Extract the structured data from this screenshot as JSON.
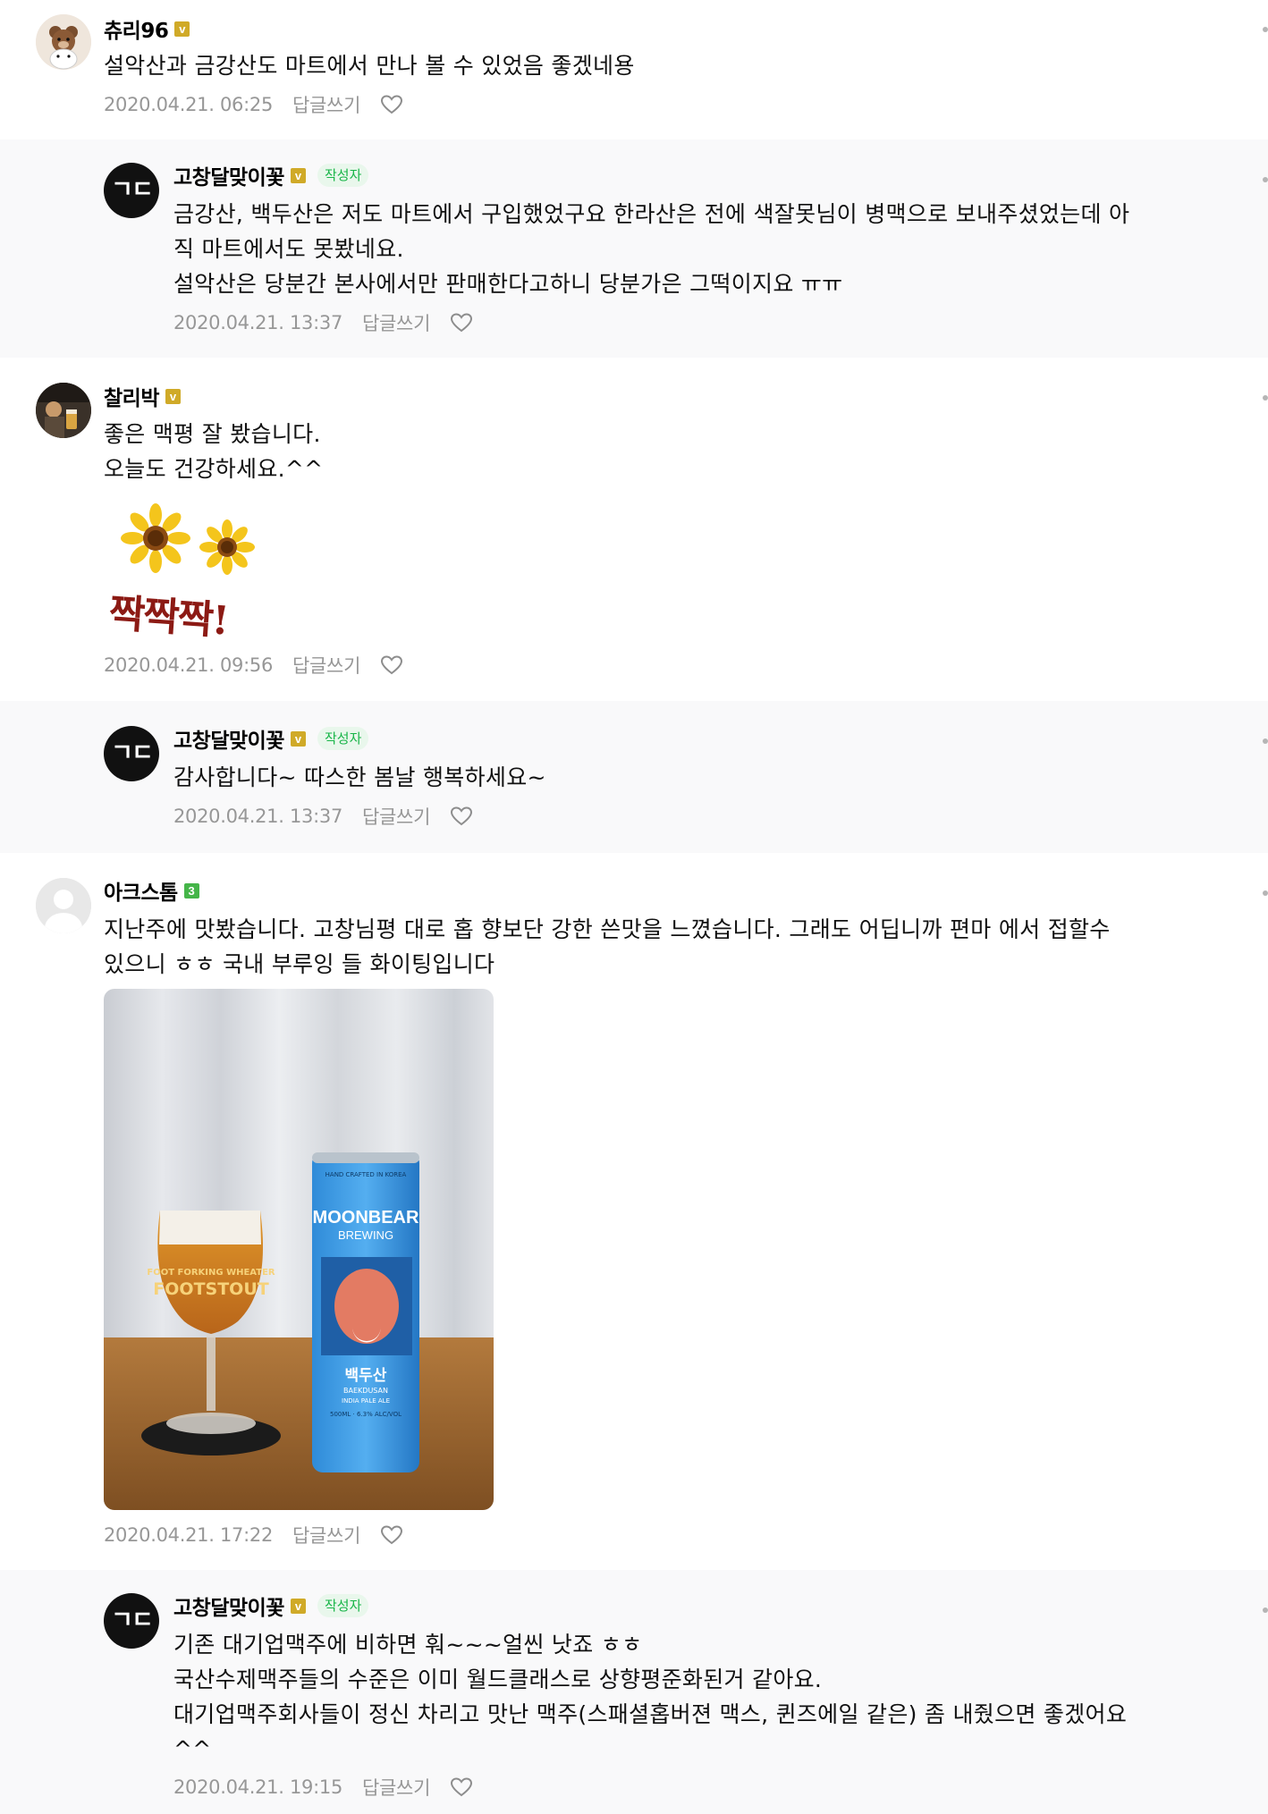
{
  "comments": [
    {
      "nickname": "츄리96",
      "badge": "v",
      "text": "설악산과 금강산도 마트에서 만나 볼 수 있었음 좋겠네용",
      "date": "2020.04.21. 06:25",
      "reply_label": "답글쓰기"
    },
    {
      "nickname": "고창달맞이꽃",
      "badge": "v",
      "author_tag": "작성자",
      "avatar_text": "ㄱㄷ",
      "text": "금강산, 백두산은 저도 마트에서 구입했었구요 한라산은 전에 색잘못님이 병맥으로 보내주셨었는데 아\n직 마트에서도 못봤네요.\n설악산은 당분간 본사에서만 판매한다고하니 당분가은 그떡이지요 ㅠㅠ",
      "date": "2020.04.21. 13:37",
      "reply_label": "답글쓰기"
    },
    {
      "nickname": "찰리박",
      "badge": "v",
      "text": "좋은 맥평 잘 봤습니다.\n오늘도 건강하세요.^^",
      "sticker_text": "짝짝짝!",
      "date": "2020.04.21. 09:56",
      "reply_label": "답글쓰기"
    },
    {
      "nickname": "고창달맞이꽃",
      "badge": "v",
      "author_tag": "작성자",
      "avatar_text": "ㄱㄷ",
      "text": "감사합니다~ 따스한 봄날 행복하세요~",
      "date": "2020.04.21. 13:37",
      "reply_label": "답글쓰기"
    },
    {
      "nickname": "아크스톰",
      "badge": "3",
      "text": "지난주에 맛봤습니다. 고창님평 대로 홉 향보단 강한 쓴맛을 느꼈습니다. 그래도 어딥니까 편마 에서 접할수\n있으니 ㅎㅎ 국내 부루잉 들 화이팅입니다",
      "photo": {
        "can_brand": "MOONBEAR",
        "can_sub": "BREWING",
        "can_top": "HAND CRAFTED IN KOREA",
        "can_name": "백두산",
        "can_name_en": "BAEKDUSAN",
        "can_style": "INDIA PALE ALE",
        "can_volume": "500ML · 6.3% ALC/VOL",
        "glass_text_1": "FOOT FORKING WHEATER",
        "glass_text_2": "FOOTSTOUT"
      },
      "date": "2020.04.21. 17:22",
      "reply_label": "답글쓰기"
    },
    {
      "nickname": "고창달맞이꽃",
      "badge": "v",
      "author_tag": "작성자",
      "avatar_text": "ㄱㄷ",
      "text": "기존 대기업맥주에 비하면 훠~~~얼씬 낫죠 ㅎㅎ\n국산수제맥주들의 수준은 이미 월드클래스로 상향평준화된거 같아요.\n대기업맥주회사들이 정신 차리고 맛난 맥주(스패셜홉버젼 맥스, 퀸즈에일 같은) 좀 내줬으면 좋겠어요\n^^",
      "date": "2020.04.21. 19:15",
      "reply_label": "답글쓰기"
    }
  ],
  "colors": {
    "reply_bg": "#f9f9fa",
    "meta_text": "#979797",
    "author_tag_text": "#18b548",
    "badge_gold": "#d0aa28",
    "badge_green": "#45b549"
  }
}
